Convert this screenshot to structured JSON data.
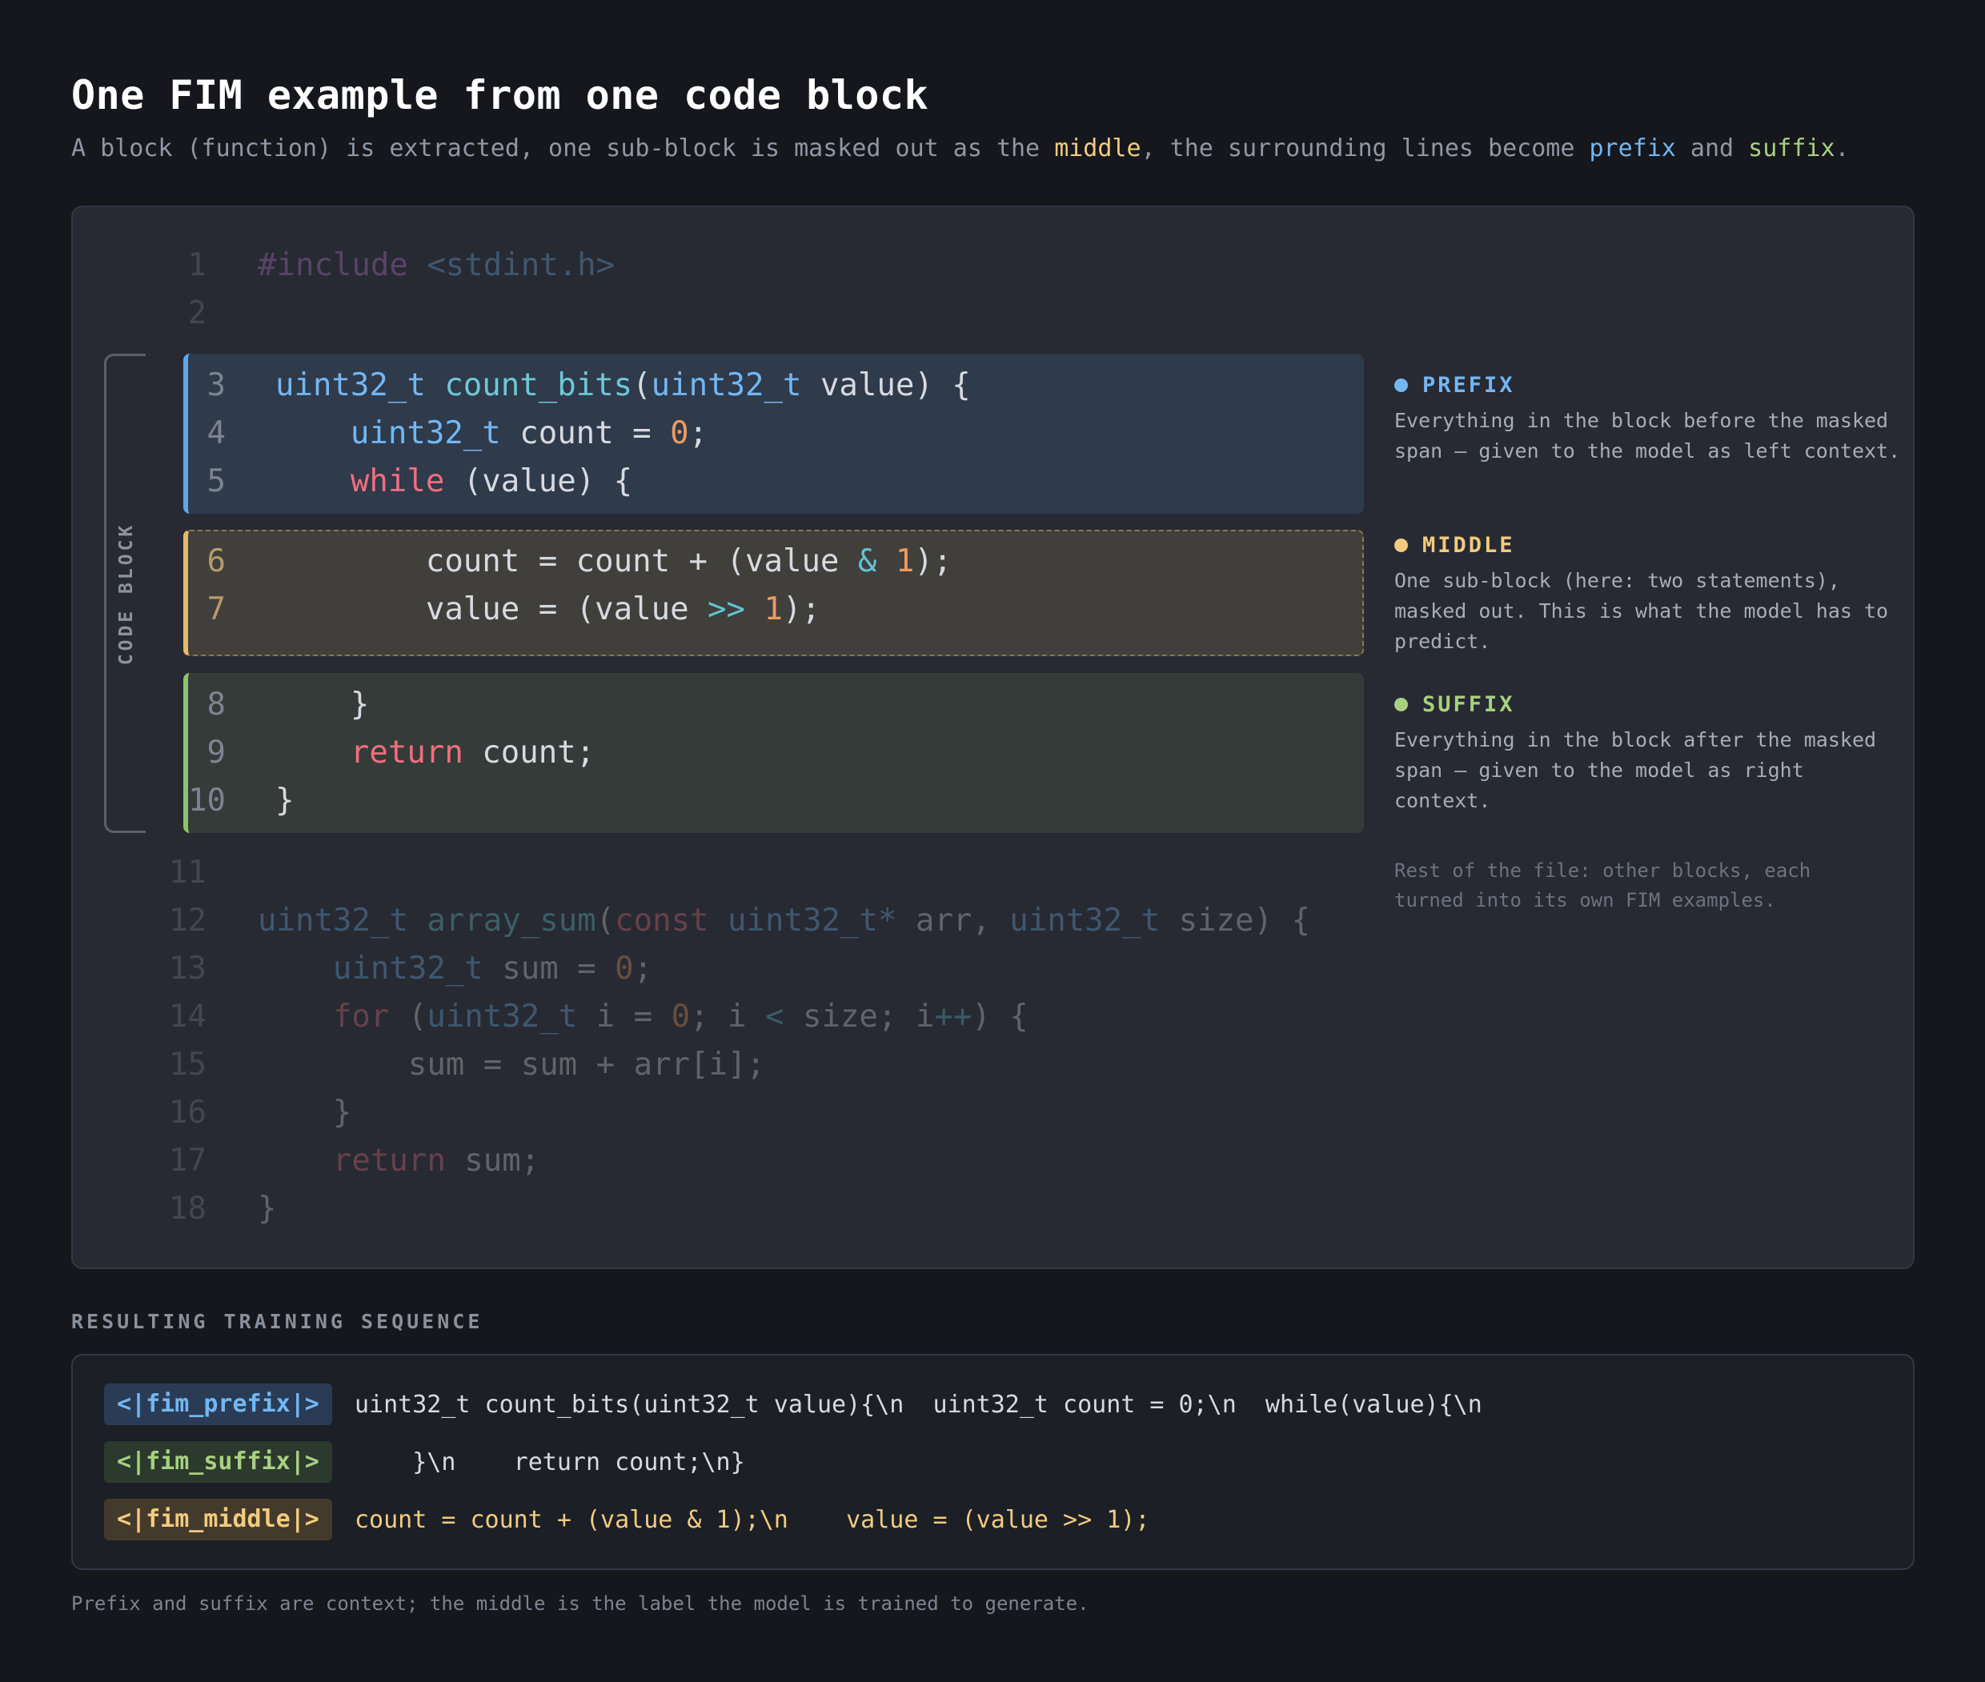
{
  "header": {
    "title": "One FIM example from one code block",
    "subtitle_pre": "A block (function) is extracted, one sub-block is masked out as the ",
    "subtitle_middle": "middle",
    "subtitle_mid": ", the surrounding lines become ",
    "subtitle_prefix": "prefix",
    "subtitle_and": " and ",
    "subtitle_suffix": "suffix",
    "subtitle_end": "."
  },
  "code": {
    "bracket_label": "CODE BLOCK",
    "lines": [
      {
        "n": "1",
        "tokens": [
          [
            "pre",
            "#include "
          ],
          [
            "str",
            "<stdint.h>"
          ]
        ]
      },
      {
        "n": "2",
        "tokens": []
      },
      {
        "n": "3",
        "tokens": [
          [
            "type",
            "uint32_t"
          ],
          [
            "txt",
            " "
          ],
          [
            "fn",
            "count_bits"
          ],
          [
            "txt",
            "("
          ],
          [
            "type",
            "uint32_t"
          ],
          [
            "txt",
            " value) {"
          ]
        ]
      },
      {
        "n": "4",
        "tokens": [
          [
            "txt",
            "    "
          ],
          [
            "type",
            "uint32_t"
          ],
          [
            "txt",
            " count = "
          ],
          [
            "num",
            "0"
          ],
          [
            "txt",
            ";"
          ]
        ]
      },
      {
        "n": "5",
        "tokens": [
          [
            "txt",
            "    "
          ],
          [
            "kw",
            "while"
          ],
          [
            "txt",
            " (value) {"
          ]
        ]
      },
      {
        "n": "6",
        "tokens": [
          [
            "txt",
            "        count = count + (value "
          ],
          [
            "op",
            "&"
          ],
          [
            "txt",
            " "
          ],
          [
            "num",
            "1"
          ],
          [
            "txt",
            ");"
          ]
        ]
      },
      {
        "n": "7",
        "tokens": [
          [
            "txt",
            "        value = (value "
          ],
          [
            "op",
            ">>"
          ],
          [
            "txt",
            " "
          ],
          [
            "num",
            "1"
          ],
          [
            "txt",
            ");"
          ]
        ]
      },
      {
        "n": "8",
        "tokens": [
          [
            "txt",
            "    }"
          ]
        ]
      },
      {
        "n": "9",
        "tokens": [
          [
            "txt",
            "    "
          ],
          [
            "kw",
            "return"
          ],
          [
            "txt",
            " count;"
          ]
        ]
      },
      {
        "n": "10",
        "tokens": [
          [
            "txt",
            "}"
          ]
        ]
      },
      {
        "n": "11",
        "tokens": []
      },
      {
        "n": "12",
        "tokens": [
          [
            "type",
            "uint32_t"
          ],
          [
            "txt",
            " "
          ],
          [
            "fn",
            "array_sum"
          ],
          [
            "txt",
            "("
          ],
          [
            "kw",
            "const"
          ],
          [
            "txt",
            " "
          ],
          [
            "type",
            "uint32_t*"
          ],
          [
            "txt",
            " arr, "
          ],
          [
            "type",
            "uint32_t"
          ],
          [
            "txt",
            " size) {"
          ]
        ]
      },
      {
        "n": "13",
        "tokens": [
          [
            "txt",
            "    "
          ],
          [
            "type",
            "uint32_t"
          ],
          [
            "txt",
            " sum = "
          ],
          [
            "num",
            "0"
          ],
          [
            "txt",
            ";"
          ]
        ]
      },
      {
        "n": "14",
        "tokens": [
          [
            "txt",
            "    "
          ],
          [
            "kw",
            "for"
          ],
          [
            "txt",
            " ("
          ],
          [
            "type",
            "uint32_t"
          ],
          [
            "txt",
            " i = "
          ],
          [
            "num",
            "0"
          ],
          [
            "txt",
            "; i "
          ],
          [
            "op",
            "<"
          ],
          [
            "txt",
            " size; i"
          ],
          [
            "op",
            "++"
          ],
          [
            "txt",
            ") {"
          ]
        ]
      },
      {
        "n": "15",
        "tokens": [
          [
            "txt",
            "        sum = sum + arr[i];"
          ]
        ]
      },
      {
        "n": "16",
        "tokens": [
          [
            "txt",
            "    }"
          ]
        ]
      },
      {
        "n": "17",
        "tokens": [
          [
            "txt",
            "    "
          ],
          [
            "kw",
            "return"
          ],
          [
            "txt",
            " sum;"
          ]
        ]
      },
      {
        "n": "18",
        "tokens": [
          [
            "txt",
            "}"
          ]
        ]
      }
    ]
  },
  "legend": {
    "prefix": {
      "label": "PREFIX",
      "desc": "Everything in the block before the masked span — given to the model as left context."
    },
    "middle": {
      "label": "MIDDLE",
      "desc": "One sub-block (here: two statements), masked out. This is what the model has to predict."
    },
    "suffix": {
      "label": "SUFFIX",
      "desc": "Everything in the block after the masked span — given to the model as right context."
    },
    "rest": "Rest of the file: other blocks, each turned into its own FIM examples."
  },
  "sequence": {
    "section_label": "RESULTING TRAINING SEQUENCE",
    "rows": [
      {
        "token": "<|fim_prefix|>",
        "text": "uint32_t count_bits(uint32_t value){\\n  uint32_t count = 0;\\n  while(value){\\n"
      },
      {
        "token": "<|fim_suffix|>",
        "text": "    }\\n    return count;\\n}"
      },
      {
        "token": "<|fim_middle|>",
        "text": "count = count + (value & 1);\\n    value = (value >> 1);"
      }
    ],
    "footnote": "Prefix and suffix are context; the middle is the label the model is trained to generate."
  },
  "colors": {
    "prefix": "#72b7f4",
    "middle": "#f3cb7e",
    "suffix": "#a8d17f",
    "background": "#15171c",
    "panel": "#272a32"
  }
}
